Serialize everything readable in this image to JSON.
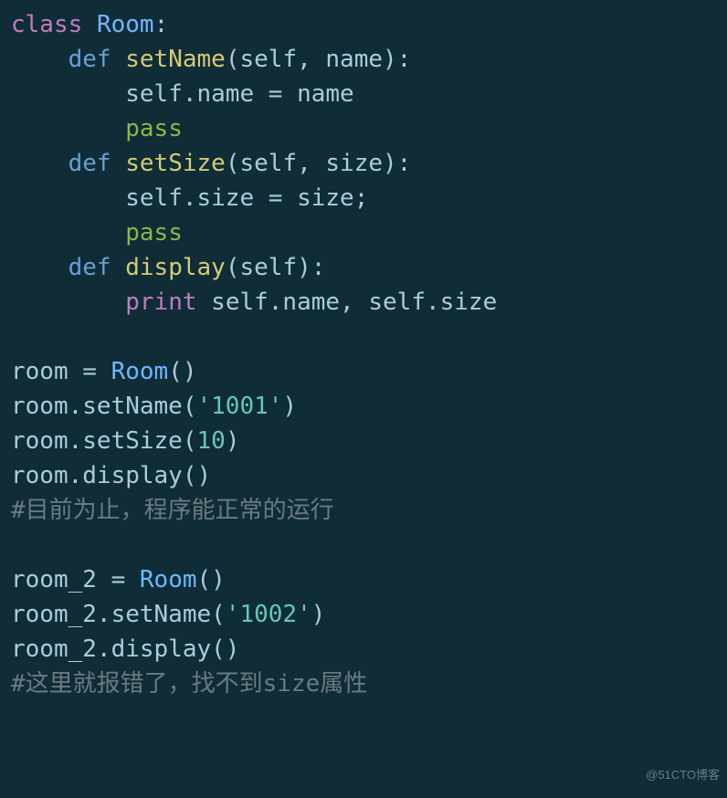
{
  "code": {
    "l1_class": "class",
    "l1_Room": "Room",
    "l1_colon": ":",
    "l2_def": "def",
    "l2_fn": "setName",
    "l2_args": "(self, name):",
    "l3": "self.name = name",
    "l4_pass": "pass",
    "l5_def": "def",
    "l5_fn": "setSize",
    "l5_args": "(self, size):",
    "l6": "self.size = size;",
    "l7_pass": "pass",
    "l8_def": "def",
    "l8_fn": "display",
    "l8_args": "(self):",
    "l9_print": "print",
    "l9_rest": " self.name, self.size",
    "l11": "room = ",
    "l11_Room": "Room",
    "l11_par": "()",
    "l12a": "room.setName(",
    "l12s": "'1001'",
    "l12b": ")",
    "l13a": "room.setSize(",
    "l13n": "10",
    "l13b": ")",
    "l14": "room.display()",
    "l15_comment": "#目前为止，程序能正常的运行",
    "l17": "room_2 = ",
    "l17_Room": "Room",
    "l17_par": "()",
    "l18a": "room_2.setName(",
    "l18s": "'1002'",
    "l18b": ")",
    "l19": "room_2.display()",
    "l20_comment": "#这里就报错了，找不到size属性"
  },
  "watermark": "@51CTO博客"
}
